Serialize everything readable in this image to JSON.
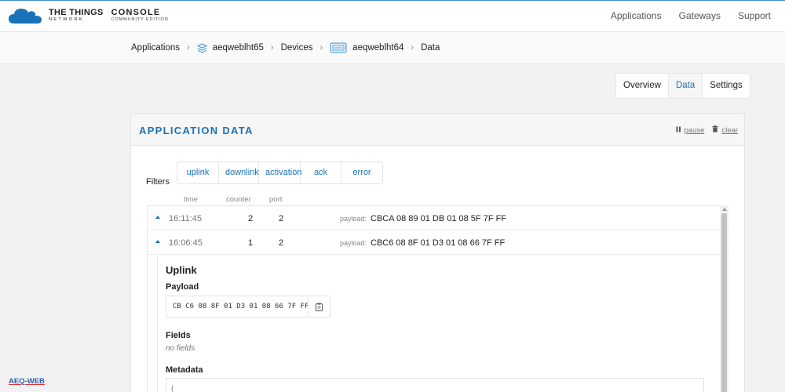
{
  "brand": {
    "line1": "THE THINGS",
    "line2": "NETWORK",
    "console": "CONSOLE",
    "edition": "COMMUNITY EDITION"
  },
  "topnav": [
    "Applications",
    "Gateways",
    "Support"
  ],
  "breadcrumb": {
    "applications": "Applications",
    "app_id": "aeqweblht65",
    "devices": "Devices",
    "device_id": "aeqweblht64",
    "data": "Data"
  },
  "tabs": [
    "Overview",
    "Data",
    "Settings"
  ],
  "panel": {
    "title": "APPLICATION DATA",
    "pause": "pause",
    "clear": "clear",
    "filters_label": "Filters",
    "filters": [
      "uplink",
      "downlink",
      "activation",
      "ack",
      "error"
    ],
    "columns": {
      "time": "time",
      "counter": "counter",
      "port": "port"
    }
  },
  "rows": [
    {
      "time": "16:11:45",
      "counter": "2",
      "port": "2",
      "payload_label": "payload:",
      "payload": "CBCA 08 89 01 DB 01 08 5F 7F FF"
    },
    {
      "time": "16:06:45",
      "counter": "1",
      "port": "2",
      "payload_label": "payload:",
      "payload": "CBC6 08 8F 01 D3 01 08 66 7F FF"
    }
  ],
  "detail": {
    "heading": "Uplink",
    "payload_heading": "Payload",
    "payload_hex": "CB C6 08 8F 01 D3 01 08 66 7F FF",
    "fields_heading": "Fields",
    "no_fields": "no fields",
    "metadata_heading": "Metadata",
    "metadata_preview": "{"
  },
  "watermark": "AEQ-WEB",
  "colors": {
    "accent": "#1a73b8",
    "topline": "#3c8fd1"
  }
}
